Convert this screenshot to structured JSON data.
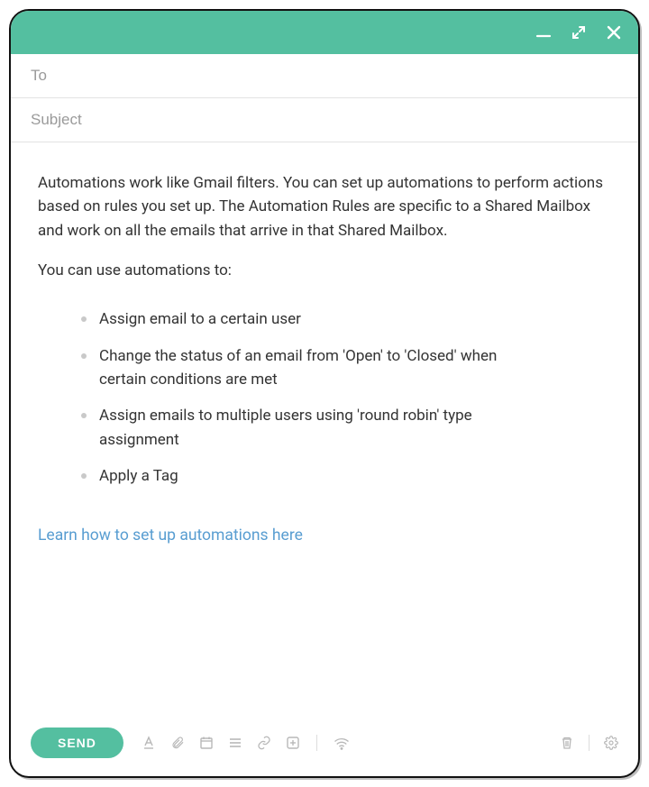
{
  "colors": {
    "accent": "#54bfa0",
    "link": "#589dd1"
  },
  "fields": {
    "to_placeholder": "To",
    "to_value": "",
    "subject_placeholder": "Subject",
    "subject_value": ""
  },
  "body": {
    "intro": "Automations work like Gmail filters. You can set up automations to perform actions based on rules you set up. The Automation Rules are specific to a Shared Mailbox and work on all the emails that arrive in that Shared Mailbox.",
    "lead": "You can use automations to:",
    "bullets": [
      "Assign email to a certain user",
      "Change the status of an email from 'Open' to 'Closed' when certain conditions are met",
      "Assign emails to multiple users using 'round robin' type assignment",
      "Apply a Tag"
    ],
    "link_text": "Learn how to set up automations here"
  },
  "footer": {
    "send_label": "SEND"
  }
}
